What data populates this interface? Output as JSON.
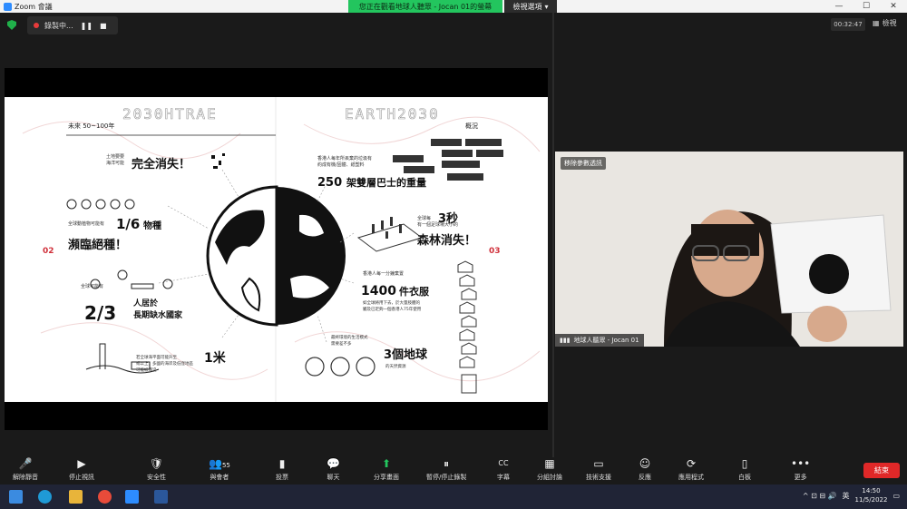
{
  "titlebar": {
    "app": "Zoom 會議",
    "banner": "您正在觀看地球人聽眾 - Jocan 01的螢幕",
    "view_options": "檢視選項",
    "min": "—",
    "max": "☐",
    "close": "✕"
  },
  "recording": {
    "label": "錄製中...",
    "pause": "❚❚",
    "stop": "■",
    "timer": "00:32:47",
    "view_label": "檢視"
  },
  "slide": {
    "title_left_mirror": "2030HTRAE",
    "title_right": "EARTH2030",
    "subtitle_left": "未來 50~100年",
    "subtitle_right": "概況",
    "p1_small_1": "土地要要",
    "p1_small_2": "海洋可能",
    "p1_big": "完全消失！",
    "p2_small": "全球動植物可能有",
    "p2_frac": "1/6",
    "p2_unit": "物種",
    "p2_big": "瀕臨絕種！",
    "p3_small": "全球可能有",
    "p3_frac": "2/3",
    "p3_t1": "人居於",
    "p3_t2": "長期缺水國家",
    "p4_big": "1米",
    "p4_s1": "若全球海平面可能升至",
    "p4_s2": "或以上，多國的海岸及低窪地區",
    "p4_s3": "可能被淹沒",
    "r1_s1": "香港人每年所丟棄的垃圾有",
    "r1_s2": "約成有機/固體、紙塑料",
    "r1_big": "250",
    "r1_rest": "架雙層巴士的重量",
    "r2_s1": "全球每",
    "r2_s2": "有一個足球場大小的",
    "r2_num": "3秒",
    "r2_big": "森林消失！",
    "r3_s1": "香港人每一分鐘棄置",
    "r3_big": "1400",
    "r3_unit": "件衣服",
    "r3_s2": "如全球將用下去，於大量肢體的",
    "r3_s3": "觸及已足夠一個香港人75年使用",
    "r4_s1": "最終環境的生活模式",
    "r4_s2": "需要差不多",
    "r4_big": "3個地球",
    "r4_s3": "的天然資源",
    "num_left": "02",
    "num_right": "03"
  },
  "video": {
    "share_tag": "移除參數透訊",
    "name": "地球人聽眾 - Jocan 01"
  },
  "toolbar": [
    {
      "icon": "🎤",
      "label": "解除靜音"
    },
    {
      "icon": "▶",
      "label": "停止視訊"
    },
    {
      "icon": "🛡",
      "label": "安全性"
    },
    {
      "icon": "👥",
      "label": "與會者",
      "count": "55"
    },
    {
      "icon": "▮",
      "label": "投票"
    },
    {
      "icon": "💬",
      "label": "聊天"
    },
    {
      "icon": "⬆",
      "label": "分享畫面"
    },
    {
      "icon": "⏸",
      "label": "暫停/停止錄製"
    },
    {
      "icon": "CC",
      "label": "字幕"
    },
    {
      "icon": "▦",
      "label": "分組討論"
    },
    {
      "icon": "▭",
      "label": "技術支援"
    },
    {
      "icon": "☺",
      "label": "反應"
    },
    {
      "icon": "⟳",
      "label": "應用程式"
    },
    {
      "icon": "▯",
      "label": "白板"
    },
    {
      "icon": "•••",
      "label": "更多"
    }
  ],
  "end_button": "結束",
  "taskbar": {
    "time": "14:50",
    "date": "11/5/2022",
    "lang": "英",
    "tray_icons": "^ ⊡ ⊟ 🔊"
  },
  "colors": {
    "banner": "#23c55e",
    "end": "#e02828",
    "shield": "#20b04a",
    "slide_red": "#d0303a"
  }
}
